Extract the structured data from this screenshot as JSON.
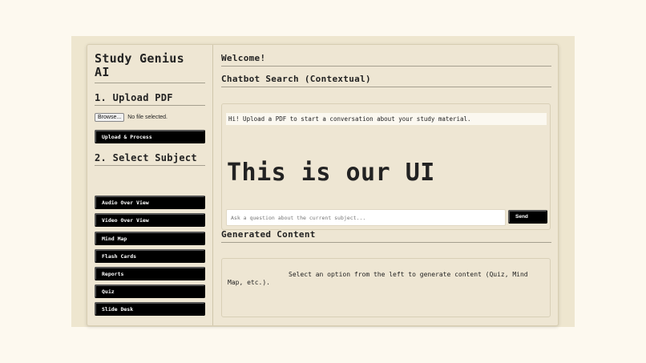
{
  "sidebar": {
    "app_title": "Study Genius AI",
    "upload_heading": "1. Upload PDF",
    "browse_label": "Browse...",
    "file_status": "No file selected.",
    "upload_button": "Upload & Process",
    "subject_heading": "2. Select Subject",
    "options": [
      "Audio Over View",
      "Video Over View",
      "Mind Map",
      "Flash Cards",
      "Reports",
      "Quiz",
      "Slide Desk"
    ]
  },
  "main": {
    "welcome": "Welcome!",
    "chat_heading": "Chatbot Search (Contextual)",
    "bot_message": "Hi! Upload a PDF to start a conversation about your study material.",
    "big_text": "This is our UI",
    "input_placeholder": "Ask a question about the current subject...",
    "send_label": "Send",
    "generated_heading": "Generated Content",
    "generated_placeholder": "Select an option from the left to generate content (Quiz, Mind Map, etc.)."
  }
}
